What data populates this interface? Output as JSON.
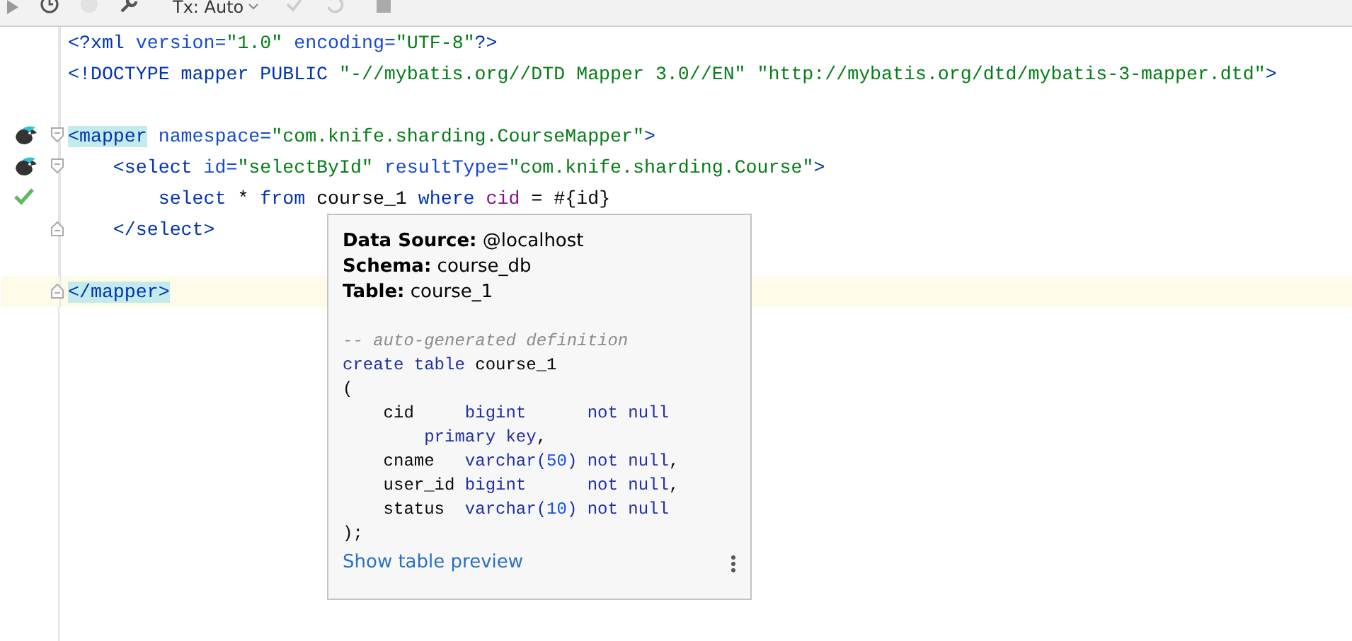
{
  "toolbar": {
    "tx_mode": "Tx: Auto"
  },
  "editor": {
    "lines": [
      {
        "mapper_icon": false,
        "verified": false,
        "fold_start": false,
        "fold_end": false,
        "current": false,
        "tokens": [
          {
            "text": "<?xml ",
            "kind": "tag"
          },
          {
            "text": "version=",
            "kind": "attr"
          },
          {
            "text": "\"1.0\"",
            "kind": "str"
          },
          {
            "text": " encoding=",
            "kind": "attr"
          },
          {
            "text": "\"UTF-8\"",
            "kind": "str"
          },
          {
            "text": "?>",
            "kind": "tag"
          }
        ]
      },
      {
        "mapper_icon": false,
        "verified": false,
        "fold_start": false,
        "fold_end": false,
        "current": false,
        "tokens": [
          {
            "text": "<!DOCTYPE mapper PUBLIC ",
            "kind": "tag"
          },
          {
            "text": "\"-//mybatis.org//DTD Mapper 3.0//EN\" \"http://mybatis.org/dtd/mybatis-3-mapper.dtd\"",
            "kind": "str"
          },
          {
            "text": ">",
            "kind": "tag"
          }
        ]
      },
      {
        "mapper_icon": false,
        "verified": false,
        "fold_start": false,
        "fold_end": false,
        "current": false
      },
      {
        "mapper_icon": true,
        "verified": false,
        "fold_start": true,
        "fold_end": false,
        "current": false,
        "tokens": [
          {
            "text": "<mapper",
            "kind": "tag",
            "matched": true
          },
          {
            "text": " namespace=",
            "kind": "attr",
            "matched": false
          },
          {
            "text": "\"com.knife.sharding.CourseMapper\"",
            "kind": "str"
          },
          {
            "text": ">",
            "kind": "tag"
          }
        ]
      },
      {
        "mapper_icon": true,
        "verified": false,
        "fold_start": true,
        "fold_end": false,
        "current": false,
        "tokens": [
          {
            "text": "    <select",
            "kind": "tag"
          },
          {
            "text": " id=",
            "kind": "attr"
          },
          {
            "text": "\"selectById\"",
            "kind": "str"
          },
          {
            "text": " resultType=",
            "kind": "attr"
          },
          {
            "text": "\"com.knife.sharding.Course\"",
            "kind": "str"
          },
          {
            "text": ">",
            "kind": "tag"
          }
        ]
      },
      {
        "mapper_icon": false,
        "verified": true,
        "fold_start": false,
        "fold_end": false,
        "current": false,
        "tokens": [
          {
            "text": "        select",
            "kind": "kw"
          },
          {
            "text": " * ",
            "kind": "plain"
          },
          {
            "text": "from",
            "kind": "kw"
          },
          {
            "text": " course_1 ",
            "kind": "plain"
          },
          {
            "text": "where",
            "kind": "kw"
          },
          {
            "text": " cid",
            "kind": "col"
          },
          {
            "text": " = #{id}",
            "kind": "plain"
          }
        ]
      },
      {
        "mapper_icon": false,
        "verified": false,
        "fold_start": false,
        "fold_end": true,
        "current": false,
        "tokens": [
          {
            "text": "    </select>",
            "kind": "tag"
          }
        ]
      },
      {
        "mapper_icon": false,
        "verified": false,
        "fold_start": false,
        "fold_end": false,
        "current": false
      },
      {
        "mapper_icon": false,
        "verified": false,
        "fold_start": false,
        "fold_end": true,
        "current": true,
        "tokens": [
          {
            "text": "</mapper>",
            "kind": "tag",
            "matched": true
          }
        ]
      }
    ]
  },
  "tooltip": {
    "info": [
      "**Data Source:** @localhost",
      "**Schema:** course_db",
      "**Table:** course_1"
    ],
    "ddl": [
      [
        {
          "text": "-- auto-generated definition",
          "kind": "cmt"
        }
      ],
      [
        {
          "text": "create table",
          "kind": "kw"
        },
        {
          "text": " course_1",
          "kind": "plain"
        }
      ],
      [
        {
          "text": "(",
          "kind": "plain"
        }
      ],
      [
        {
          "text": "    cid     ",
          "kind": "col"
        },
        {
          "text": "bigint      not null",
          "kind": "kw"
        }
      ],
      [
        {
          "text": "        primary key",
          "kind": "kw"
        },
        {
          "text": ",",
          "kind": "plain"
        }
      ],
      [
        {
          "text": "    cname   ",
          "kind": "col"
        },
        {
          "text": "varchar(",
          "kind": "kw"
        },
        {
          "text": "50",
          "kind": "num"
        },
        {
          "text": ") not null",
          "kind": "kw"
        },
        {
          "text": ",",
          "kind": "plain"
        }
      ],
      [
        {
          "text": "    user_id ",
          "kind": "col"
        },
        {
          "text": "bigint      not null",
          "kind": "kw"
        },
        {
          "text": ",",
          "kind": "plain"
        }
      ],
      [
        {
          "text": "    status  ",
          "kind": "col"
        },
        {
          "text": "varchar(",
          "kind": "kw"
        },
        {
          "text": "10",
          "kind": "num"
        },
        {
          "text": ") not null",
          "kind": "kw"
        }
      ],
      [
        {
          "text": ");",
          "kind": "plain"
        }
      ]
    ],
    "link": "Show table preview"
  }
}
